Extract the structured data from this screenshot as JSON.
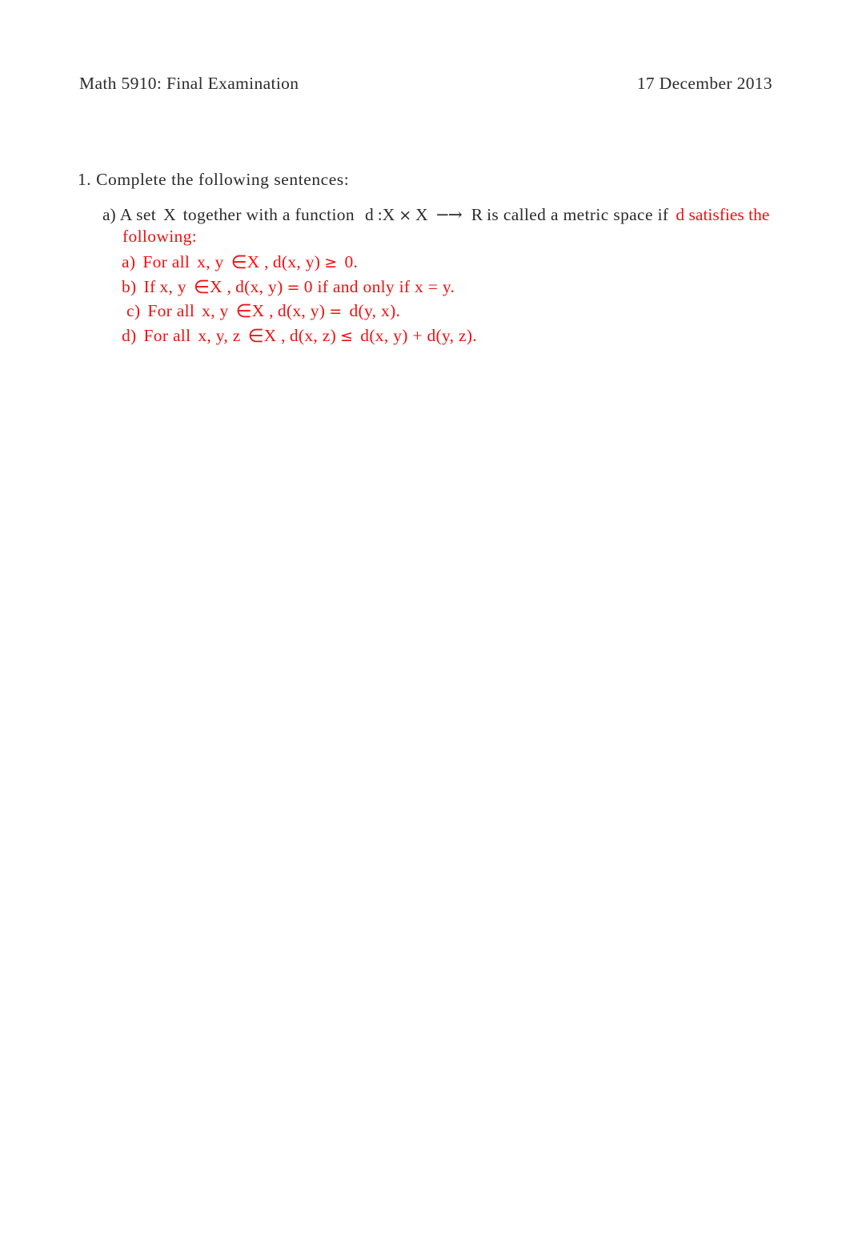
{
  "document": {
    "header": {
      "course_title": "Math 5910: Final Examination",
      "date": "17 December 2013"
    },
    "question": {
      "number_and_prompt": "1. Complete the following sentences:",
      "parts": [
        {
          "label": "a)",
          "prompt_before": "A set",
          "set_symbol": "X",
          "prompt_middle": "together with a function",
          "function_decl_d": "d",
          "function_decl_colon": ":",
          "function_domain_x1": "X",
          "function_times": "×",
          "function_domain_x2": "X",
          "function_arrow": "−→",
          "function_codomain": "R",
          "prompt_after": "is called a metric space if",
          "answer_line1": "d satisfies the",
          "answer_line2": "following:"
        }
      ]
    },
    "answers": {
      "color": "#ee1111",
      "items": [
        {
          "label": "a)",
          "quantifier": "For all",
          "vars": "x, y",
          "member": "∈",
          "set": "X ,",
          "expr_left": "d(x, y)",
          "relation": "≥",
          "expr_right": "0.",
          "full_text": "a) For all  x, y ∈X , d(x, y) ≥  0."
        },
        {
          "label": "b)",
          "quantifier": "If",
          "vars": "x, y",
          "member": "∈",
          "set": "X ,",
          "expr_left": "d(x, y)",
          "relation": "=",
          "expr_right": "0 if and only if  x =  y.",
          "full_text": "b) If x, y ∈X , d(x, y) = 0 if and only if  x =  y."
        },
        {
          "label": "c)",
          "quantifier": "For all",
          "vars": "x, y",
          "member": "∈",
          "set": "X ,",
          "expr_left": "d(x, y)",
          "relation": "=",
          "expr_right": "d(y, x).",
          "full_text": "c) For all  x, y ∈X , d(x, y) =  d(y, x)."
        },
        {
          "label": "d)",
          "quantifier": "For all",
          "vars": "x, y, z",
          "member": "∈",
          "set": "X ,",
          "expr_left": "d(x, z)",
          "relation": "≤",
          "expr_right": "d(x, y) +  d(y, z).",
          "full_text": "d) For all  x, y, z ∈X , d(x, z) ≤  d(x, y) +  d(y, z)."
        }
      ]
    },
    "colors": {
      "text": "#2b2b2b",
      "answer_red": "#ee1111",
      "page_background": "#ffffff"
    }
  }
}
